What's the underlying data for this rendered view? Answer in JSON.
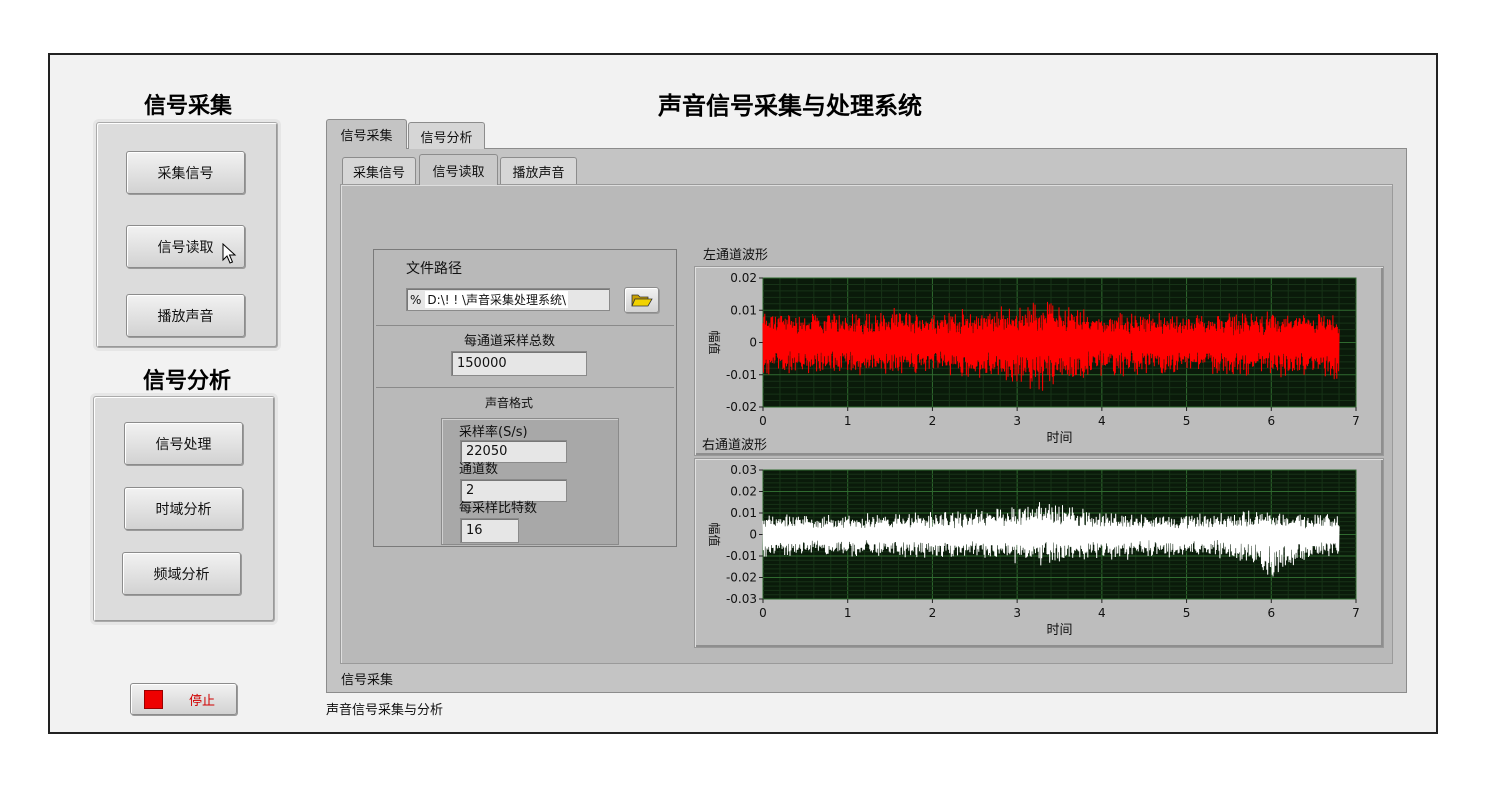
{
  "app": {
    "title": "声音信号采集与处理系统",
    "footer": "声音信号采集与分析"
  },
  "left": {
    "acq_heading": "信号采集",
    "acq_buttons": [
      "采集信号",
      "信号读取",
      "播放声音"
    ],
    "ana_heading": "信号分析",
    "ana_buttons": [
      "信号处理",
      "时域分析",
      "频域分析"
    ],
    "stop_label": "停止",
    "stop_color": "#ee0000"
  },
  "tabs": {
    "outer": [
      "信号采集",
      "信号分析"
    ],
    "outer_active": "信号采集",
    "inner": [
      "采集信号",
      "信号读取",
      "播放声音"
    ],
    "inner_active": "信号读取",
    "status": "信号采集"
  },
  "read": {
    "path_label": "文件路径",
    "path_prefix": "%",
    "path_value": "D:\\!  !  \\声音采集处理系统\\",
    "samples_label": "每通道采样总数",
    "samples_value": "150000",
    "format_label": "声音格式",
    "rate_label": "采样率(S/s)",
    "rate_value": "22050",
    "channels_label": "通道数",
    "channels_value": "2",
    "bits_label": "每采样比特数",
    "bits_value": "16"
  },
  "chart_data": [
    {
      "type": "line",
      "title": "左通道波形",
      "xlabel": "时间",
      "ylabel": "幅值",
      "xlim": [
        0,
        7
      ],
      "ylim": [
        -0.02,
        0.02
      ],
      "xticks": [
        "0",
        "1",
        "2",
        "3",
        "4",
        "5",
        "6",
        "7"
      ],
      "yticks": [
        "0.02",
        "0.01",
        "0",
        "-0.01",
        "-0.02"
      ],
      "series": [
        {
          "color": "#ff0000",
          "x": [
            0,
            0.5,
            1,
            1.5,
            2,
            2.5,
            3,
            3.25,
            3.5,
            4,
            4.5,
            5,
            5.5,
            6,
            6.5,
            6.8
          ],
          "upper": [
            0.011,
            0.01,
            0.01,
            0.011,
            0.01,
            0.011,
            0.012,
            0.014,
            0.013,
            0.01,
            0.01,
            0.009,
            0.01,
            0.01,
            0.01,
            0.009
          ],
          "lower": [
            -0.011,
            -0.01,
            -0.011,
            -0.01,
            -0.011,
            -0.012,
            -0.014,
            -0.017,
            -0.014,
            -0.011,
            -0.011,
            -0.01,
            -0.011,
            -0.011,
            -0.011,
            -0.012
          ]
        }
      ],
      "plot_bg": "#0a1a0a",
      "grid": true
    },
    {
      "type": "line",
      "title": "右通道波形",
      "xlabel": "时间",
      "ylabel": "幅值",
      "xlim": [
        0,
        7
      ],
      "ylim": [
        -0.03,
        0.03
      ],
      "xticks": [
        "0",
        "1",
        "2",
        "3",
        "4",
        "5",
        "6",
        "7"
      ],
      "yticks": [
        "0.03",
        "0.02",
        "0.01",
        "0",
        "-0.01",
        "-0.02",
        "-0.03"
      ],
      "series": [
        {
          "color": "#ffffff",
          "x": [
            0,
            0.5,
            1,
            1.5,
            2,
            2.5,
            3,
            3.25,
            3.5,
            4,
            4.5,
            5,
            5.5,
            6,
            6.5,
            6.8
          ],
          "upper": [
            0.011,
            0.01,
            0.01,
            0.011,
            0.011,
            0.012,
            0.014,
            0.019,
            0.015,
            0.012,
            0.011,
            0.01,
            0.011,
            0.012,
            0.011,
            0.01
          ],
          "lower": [
            -0.011,
            -0.01,
            -0.011,
            -0.011,
            -0.012,
            -0.012,
            -0.014,
            -0.016,
            -0.014,
            -0.012,
            -0.012,
            -0.011,
            -0.012,
            -0.022,
            -0.012,
            -0.011
          ]
        }
      ],
      "plot_bg": "#0a1a0a",
      "grid": true
    }
  ]
}
